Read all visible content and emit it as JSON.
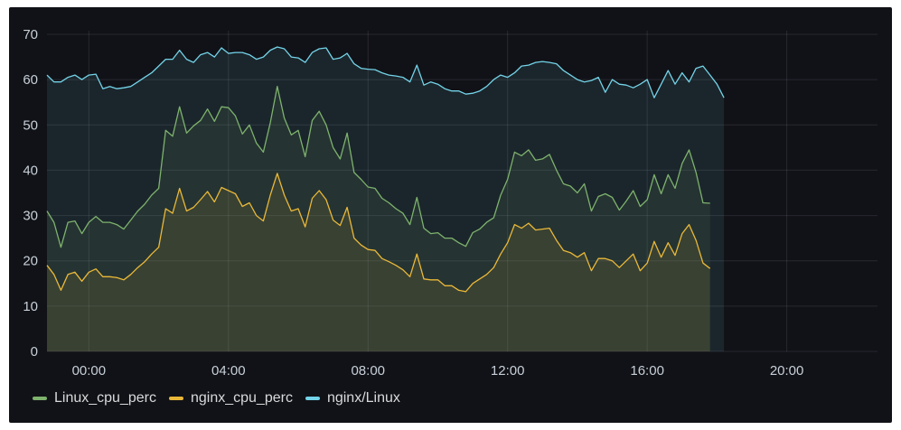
{
  "chart_data": {
    "type": "area",
    "x_ticks": [
      "00:00",
      "04:00",
      "08:00",
      "12:00",
      "16:00",
      "20:00"
    ],
    "x_tick_hours": [
      0,
      4,
      8,
      12,
      16,
      20
    ],
    "x_range_hours": [
      -1.2,
      22.6
    ],
    "y_ticks": [
      0,
      10,
      20,
      30,
      40,
      50,
      60,
      70
    ],
    "ylim": [
      0,
      70
    ],
    "grid": true,
    "legend_position": "bottom-left",
    "hours": [
      -1.2,
      -1.0,
      -0.8,
      -0.6,
      -0.4,
      -0.2,
      0.0,
      0.2,
      0.4,
      0.6,
      0.8,
      1.0,
      1.2,
      1.4,
      1.6,
      1.8,
      2.0,
      2.2,
      2.4,
      2.6,
      2.8,
      3.0,
      3.2,
      3.4,
      3.6,
      3.8,
      4.0,
      4.2,
      4.4,
      4.6,
      4.8,
      5.0,
      5.2,
      5.4,
      5.6,
      5.8,
      6.0,
      6.2,
      6.4,
      6.6,
      6.8,
      7.0,
      7.2,
      7.4,
      7.6,
      7.8,
      8.0,
      8.2,
      8.4,
      8.6,
      8.8,
      9.0,
      9.2,
      9.4,
      9.6,
      9.8,
      10.0,
      10.2,
      10.4,
      10.6,
      10.8,
      11.0,
      11.2,
      11.4,
      11.6,
      11.8,
      12.0,
      12.2,
      12.4,
      12.6,
      12.8,
      13.0,
      13.2,
      13.4,
      13.6,
      13.8,
      14.0,
      14.2,
      14.4,
      14.6,
      14.8,
      15.0,
      15.2,
      15.4,
      15.6,
      15.8,
      16.0,
      16.2,
      16.4,
      16.6,
      16.8,
      17.0,
      17.2,
      17.4,
      17.6,
      17.8,
      18.0,
      18.2,
      18.4,
      18.6,
      18.8,
      19.0,
      19.2,
      19.4,
      19.6,
      19.8,
      20.0,
      20.2,
      20.4,
      20.6,
      20.8,
      21.0,
      21.2,
      21.4,
      21.6,
      21.8,
      22.0,
      22.2,
      22.4,
      22.6
    ],
    "series": [
      {
        "name": "nginx/Linux",
        "color": "#73d3e8",
        "values": [
          61,
          59.5,
          59.5,
          60.5,
          61,
          60,
          61,
          61.2,
          58,
          58.5,
          58,
          58.2,
          58.5,
          59.5,
          60.5,
          61.5,
          63,
          64.5,
          64.5,
          66.5,
          64.5,
          63.8,
          65.5,
          66,
          65,
          67,
          65.8,
          66,
          66,
          65.5,
          64.5,
          65,
          66.5,
          67.2,
          66.8,
          65,
          64.8,
          63.8,
          66,
          66.8,
          67,
          64.5,
          64.8,
          65.8,
          63.5,
          62.5,
          62.3,
          62.2,
          61.5,
          61,
          60.8,
          60.5,
          59.5,
          63.2,
          58.8,
          59.5,
          59,
          58,
          57.5,
          57.5,
          56.8,
          57,
          57.5,
          58.5,
          60,
          61,
          60.5,
          61.5,
          63,
          63.2,
          63.8,
          64,
          63.8,
          63.5,
          62,
          61,
          60,
          59.5,
          59.8,
          60.5,
          57.2,
          60,
          59,
          58.8,
          58.2,
          59,
          60,
          56,
          59,
          62,
          59,
          61.5,
          59.5,
          62.5,
          63,
          61,
          59,
          56
        ]
      },
      {
        "name": "Linux_cpu_perc",
        "color": "#7eb26d",
        "values": [
          31,
          28.5,
          23,
          28.5,
          28.8,
          26,
          28.5,
          29.8,
          28.5,
          28.5,
          28,
          27,
          29,
          31,
          32.5,
          34.5,
          36,
          48.8,
          47.5,
          54,
          48.2,
          49.8,
          51,
          53.5,
          50.8,
          54,
          53.8,
          52,
          48,
          50,
          46,
          44,
          50.5,
          58.5,
          51.5,
          47.8,
          48.8,
          43,
          51,
          53,
          50,
          45,
          42.5,
          48.2,
          39.5,
          38,
          36.3,
          36,
          33.8,
          32.8,
          31.5,
          30.5,
          28,
          34,
          27.2,
          26,
          26.2,
          25,
          25,
          24,
          23.2,
          26.2,
          27,
          28.5,
          29.5,
          34.5,
          38,
          44,
          43.2,
          44.5,
          42.2,
          42.5,
          43.5,
          40,
          37,
          36.5,
          35,
          37,
          31,
          34.2,
          34.8,
          34,
          31.2,
          33.2,
          35.5,
          32,
          33.5,
          39,
          34.8,
          39,
          36,
          41.5,
          44.5,
          39.5,
          32.8,
          32.7
        ]
      },
      {
        "name": "nginx_cpu_perc",
        "color": "#eab839",
        "values": [
          19,
          17,
          13.5,
          17,
          17.5,
          15.5,
          17.5,
          18.2,
          16.5,
          16.5,
          16.3,
          15.8,
          17,
          18.5,
          19.8,
          21.5,
          23,
          31.5,
          30.5,
          36,
          31,
          31.8,
          33.5,
          35.3,
          33,
          36.2,
          35.5,
          34.8,
          32,
          32.8,
          30,
          28.8,
          34.5,
          39.3,
          34.5,
          31,
          31.5,
          27.5,
          33.8,
          35.5,
          33.5,
          29,
          27.8,
          31.8,
          25,
          23.5,
          22.5,
          22.3,
          20.5,
          19.8,
          19,
          18,
          16.5,
          21.5,
          16,
          15.8,
          15.8,
          14.5,
          14.5,
          13.5,
          13.2,
          15,
          16,
          17,
          18.5,
          21.5,
          24,
          28,
          27.2,
          28.3,
          26.8,
          27,
          27.2,
          24.5,
          22.3,
          21.8,
          20.8,
          21.8,
          17.8,
          20.5,
          20.5,
          20,
          18.5,
          20,
          21.5,
          17.8,
          19.5,
          24.3,
          20.8,
          24,
          21.2,
          26,
          28,
          24.5,
          19.5,
          18.3
        ]
      }
    ]
  },
  "legend": [
    {
      "label": "Linux_cpu_perc",
      "color": "#7eb26d"
    },
    {
      "label": "nginx_cpu_perc",
      "color": "#eab839"
    },
    {
      "label": "nginx/Linux",
      "color": "#73d3e8"
    }
  ]
}
